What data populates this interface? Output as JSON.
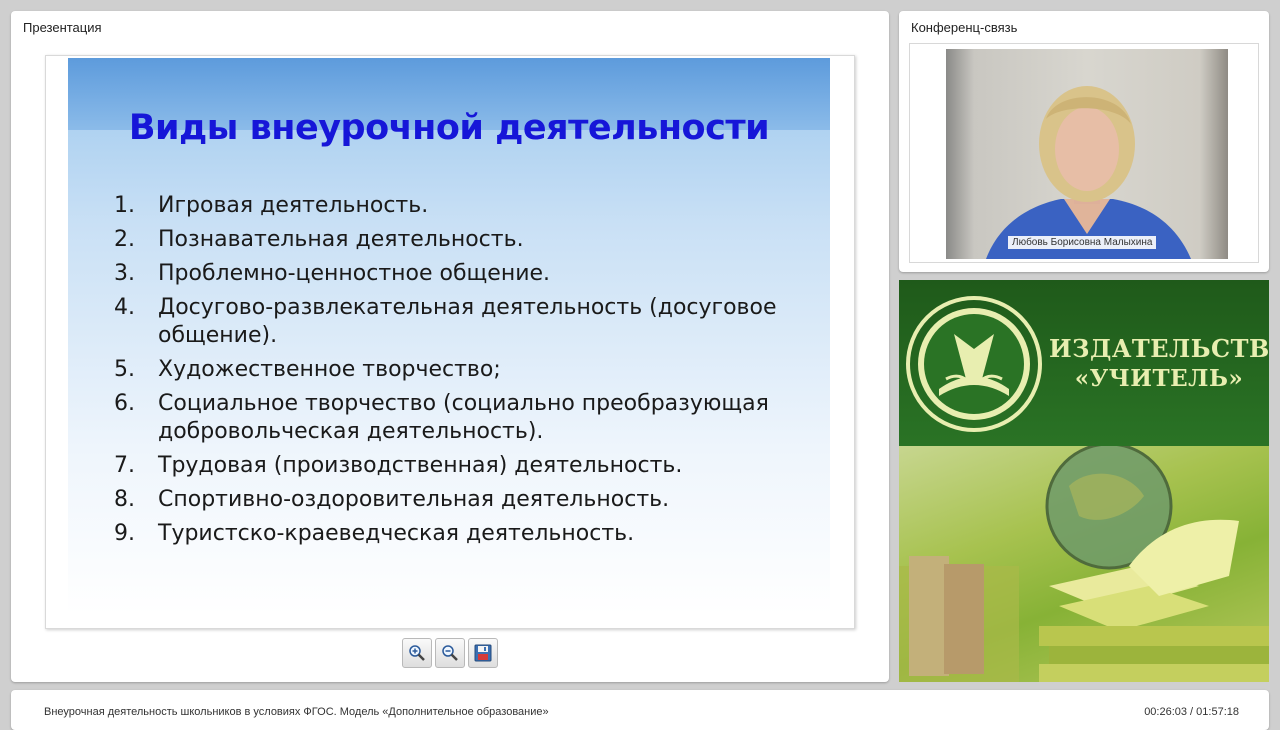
{
  "presentation": {
    "title": "Презентация",
    "slide": {
      "heading": "Виды внеурочной деятельности",
      "items": [
        {
          "num": "1.",
          "text": "Игровая деятельность."
        },
        {
          "num": "2.",
          "text": "Познавательная деятельность."
        },
        {
          "num": "3.",
          "text": "Проблемно-ценностное общение."
        },
        {
          "num": "4.",
          "text": "Досугово-развлекательная деятельность (досуговое общение)."
        },
        {
          "num": "5.",
          "text": "Художественное творчество;"
        },
        {
          "num": "6.",
          "text": "Социальное творчество (социально преобразующая добровольческая деятельность)."
        },
        {
          "num": "7.",
          "text": "Трудовая (производственная) деятельность."
        },
        {
          "num": "8.",
          "text": "Спортивно-оздоровительная деятельность."
        },
        {
          "num": "9.",
          "text": "Туристско-краеведческая деятельность."
        }
      ]
    },
    "toolbar": {
      "zoom_in_icon": "zoom-in-icon",
      "zoom_out_icon": "zoom-out-icon",
      "save_icon": "floppy-disk-icon"
    }
  },
  "conference": {
    "title": "Конференц-связь",
    "speaker_name": "Любовь Борисовна Малыхина"
  },
  "ad": {
    "line1": "ИЗДАТЕЛЬСТВО",
    "line2": "«УЧИТЕЛЬ»"
  },
  "status": {
    "course_title": "Внеурочная деятельность школьников в условиях ФГОС. Модель «Дополнительное образование»",
    "time": "00:26:03 / 01:57:18"
  },
  "colors": {
    "slide_heading": "#1616d8",
    "ad_green": "#2a7325",
    "ad_text": "#e8eeb0"
  }
}
